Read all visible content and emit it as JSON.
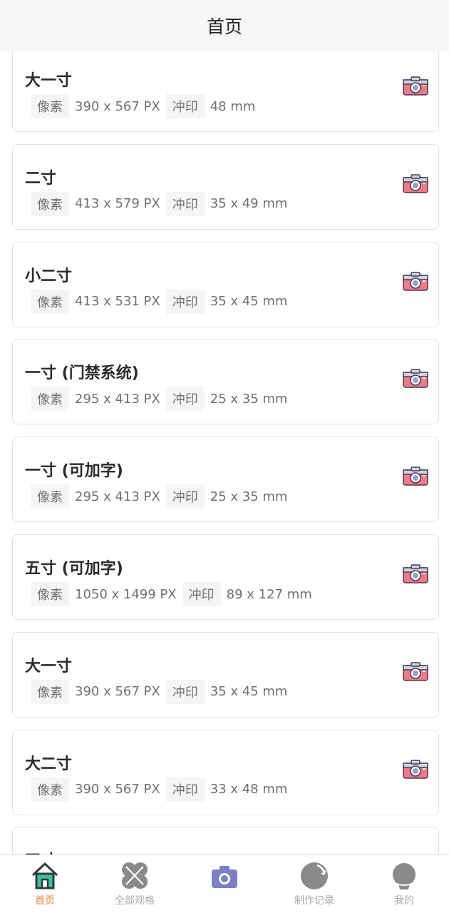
{
  "header": {
    "title": "首页"
  },
  "labels": {
    "pixel": "像素",
    "print": "冲印"
  },
  "icons": {
    "card_action": "camera-icon"
  },
  "cards": [
    {
      "title": "大一寸",
      "pixels": "390 x 567 PX",
      "print": "48 mm"
    },
    {
      "title": "二寸",
      "pixels": "413 x 579 PX",
      "print": "35 x 49 mm"
    },
    {
      "title": "小二寸",
      "pixels": "413 x 531 PX",
      "print": "35 x 45 mm"
    },
    {
      "title": "一寸 (门禁系统)",
      "pixels": "295 x 413 PX",
      "print": "25 x 35 mm"
    },
    {
      "title": "一寸 (可加字)",
      "pixels": "295 x 413 PX",
      "print": "25 x 35 mm"
    },
    {
      "title": "五寸 (可加字)",
      "pixels": "1050 x 1499 PX",
      "print": "89 x 127 mm"
    },
    {
      "title": "大一寸",
      "pixels": "390 x 567 PX",
      "print": "35 x 45 mm"
    },
    {
      "title": "大二寸",
      "pixels": "390 x 567 PX",
      "print": "33 x 48 mm"
    },
    {
      "title": "四寸",
      "pixels": "",
      "print": ""
    }
  ],
  "tabbar": {
    "active_color": "#e8863a",
    "items": [
      {
        "label": "首页",
        "icon": "home-icon",
        "active": true
      },
      {
        "label": "全部规格",
        "icon": "clover-icon",
        "active": false
      },
      {
        "label": "",
        "icon": "camera-icon",
        "active": false
      },
      {
        "label": "制作记录",
        "icon": "history-icon",
        "active": false
      },
      {
        "label": "我的",
        "icon": "user-icon",
        "active": false
      }
    ]
  }
}
